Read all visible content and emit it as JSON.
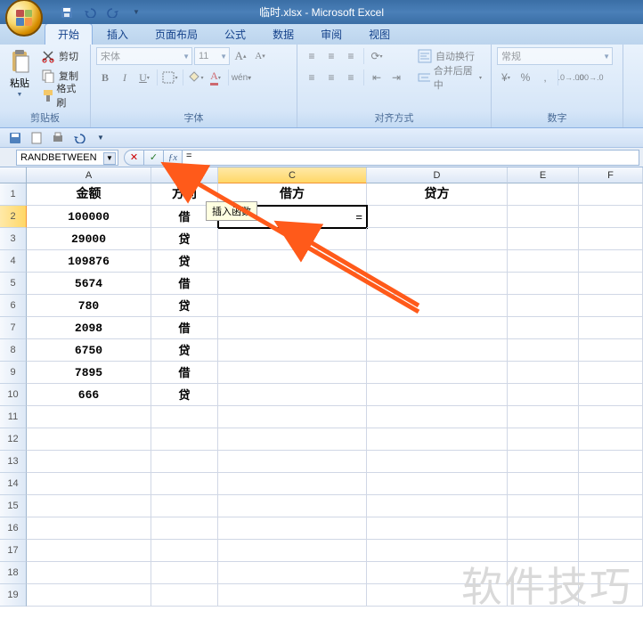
{
  "title": "临时.xlsx - Microsoft Excel",
  "tabs": [
    "开始",
    "插入",
    "页面布局",
    "公式",
    "数据",
    "审阅",
    "视图"
  ],
  "activeTab": 0,
  "clipboard": {
    "label": "剪贴板",
    "paste": "粘贴",
    "cut": "剪切",
    "copy": "复制",
    "format": "格式刷"
  },
  "font": {
    "label": "字体",
    "name": "宋体",
    "size": "11"
  },
  "align": {
    "label": "对齐方式",
    "wrap": "自动换行",
    "merge": "合并后居中"
  },
  "number": {
    "label": "数字",
    "format": "常规"
  },
  "nameBox": "RANDBETWEEN",
  "formula": "=",
  "tooltip": "插入函数",
  "columns": [
    "A",
    "B",
    "C",
    "D",
    "E",
    "F"
  ],
  "headers": {
    "A": "金额",
    "B": "方向",
    "C": "借方",
    "D": "贷方"
  },
  "rows": [
    {
      "A": "100000",
      "B": "借"
    },
    {
      "A": "29000",
      "B": "贷"
    },
    {
      "A": "109876",
      "B": "贷"
    },
    {
      "A": "5674",
      "B": "借"
    },
    {
      "A": "780",
      "B": "贷"
    },
    {
      "A": "2098",
      "B": "借"
    },
    {
      "A": "6750",
      "B": "贷"
    },
    {
      "A": "7895",
      "B": "借"
    },
    {
      "A": "666",
      "B": "贷"
    }
  ],
  "activeCell": {
    "row": 2,
    "col": "C",
    "value": "="
  },
  "watermark": "软件技巧"
}
